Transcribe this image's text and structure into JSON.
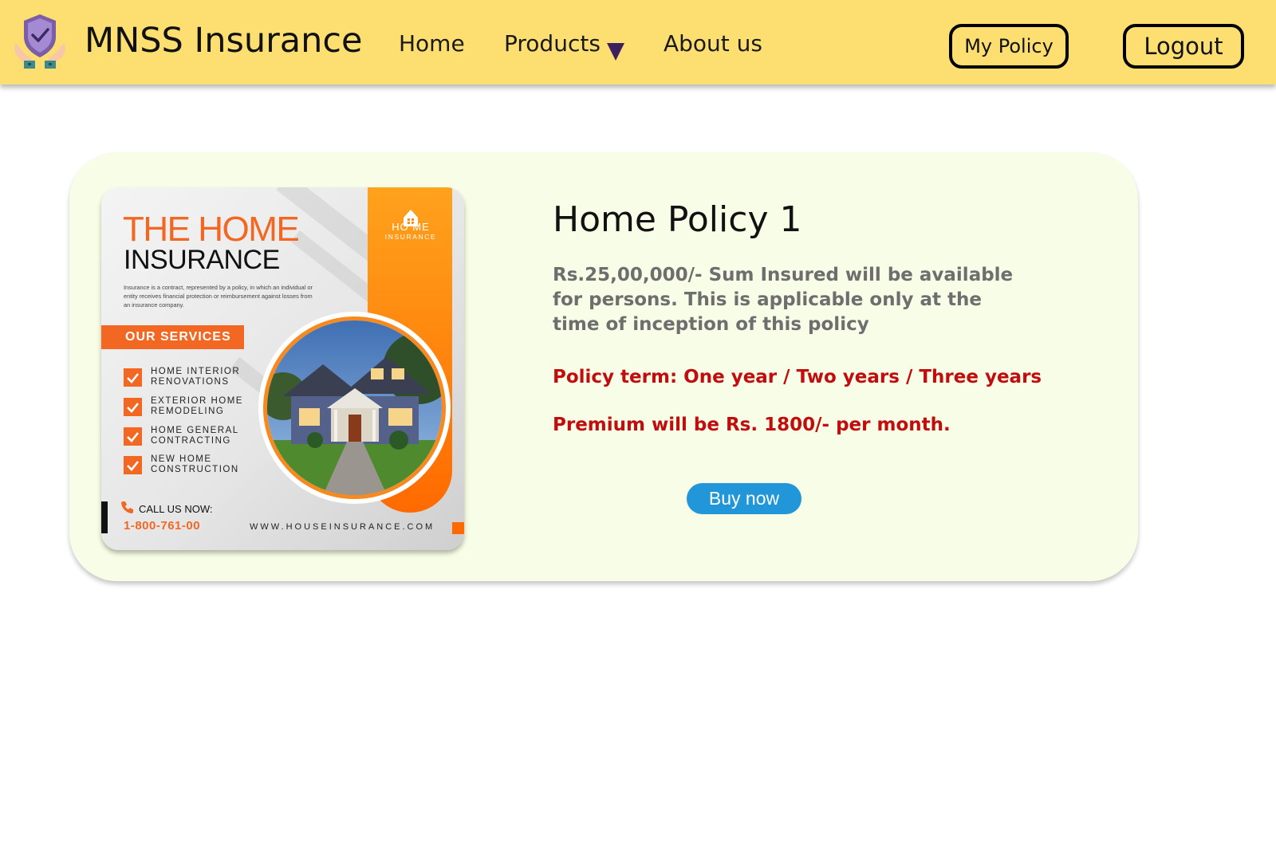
{
  "navbar": {
    "brand": "MNSS Insurance",
    "logo_icon": "shield-hands-icon",
    "links": [
      {
        "label": "Home"
      },
      {
        "label": "Products",
        "icon": "caret-down-icon"
      },
      {
        "label": "About us"
      }
    ],
    "my_policy_label": "My Policy",
    "logout_label": "Logout"
  },
  "policy": {
    "title": "Home Policy 1",
    "description": "Rs.25,00,000/- Sum Insured will be available for persons. This is applicable only at the time of inception of this policy",
    "term": "Policy term: One year / Two years / Three years",
    "premium": "Premium will be Rs. 1800/- per month.",
    "buy_label": "Buy now"
  },
  "poster": {
    "title_line1": "THE HOME",
    "title_line2": "INSURANCE",
    "description": "Insurance is a contract, represented by a policy, in which an individual or entity receives financial protection or reimbursement against losses from an insurance company.",
    "services_heading": "OUR SERVICES",
    "services": [
      {
        "line1": "HOME INTERIOR",
        "line2": "RENOVATIONS"
      },
      {
        "line1": "EXTERIOR HOME",
        "line2": "REMODELING"
      },
      {
        "line1": "HOME GENERAL",
        "line2": "CONTRACTING"
      },
      {
        "line1": "NEW HOME",
        "line2": "CONSTRUCTION"
      }
    ],
    "logo_word": "HO ME",
    "logo_sub": "INSURANCE",
    "call_label": "CALL US NOW:",
    "phone": "1-800-761-00",
    "url": "WWW.HOUSEINSURANCE.COM"
  },
  "colors": {
    "navbar_bg": "#fddf71",
    "card_bg": "#f7fde6",
    "accent_red": "#c10d0d",
    "buy_button": "#2196d8",
    "poster_orange": "#f26722"
  }
}
